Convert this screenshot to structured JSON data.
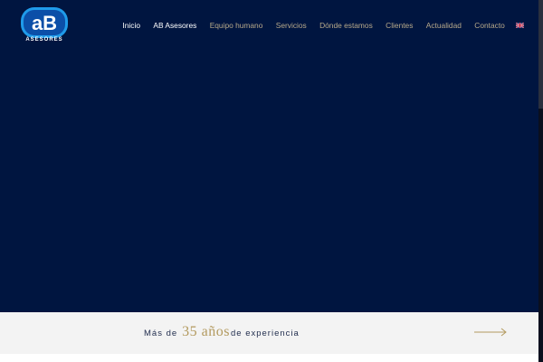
{
  "logo": {
    "subtitle": "ASESORES"
  },
  "nav": {
    "items": [
      {
        "label": "Inicio",
        "active": true
      },
      {
        "label": "AB Asesores",
        "active": true
      },
      {
        "label": "Equipo humano",
        "active": false
      },
      {
        "label": "Servicios",
        "active": false
      },
      {
        "label": "Dónde estamos",
        "active": false
      },
      {
        "label": "Clientes",
        "active": false
      },
      {
        "label": "Actualidad",
        "active": false
      },
      {
        "label": "Contacto",
        "active": false
      }
    ],
    "language_icon": "uk-flag-icon"
  },
  "band": {
    "prefix": "Más de",
    "years": "35 años",
    "suffix": "de experiencia",
    "arrow_icon": "arrow-right-icon"
  },
  "colors": {
    "hero_background": "#001540",
    "nav_text": "#b7a98a",
    "nav_active": "#ffffff",
    "band_background": "#f3f3f3",
    "accent_gold": "#b39a5f",
    "logo_blue": "#1f9bea"
  }
}
